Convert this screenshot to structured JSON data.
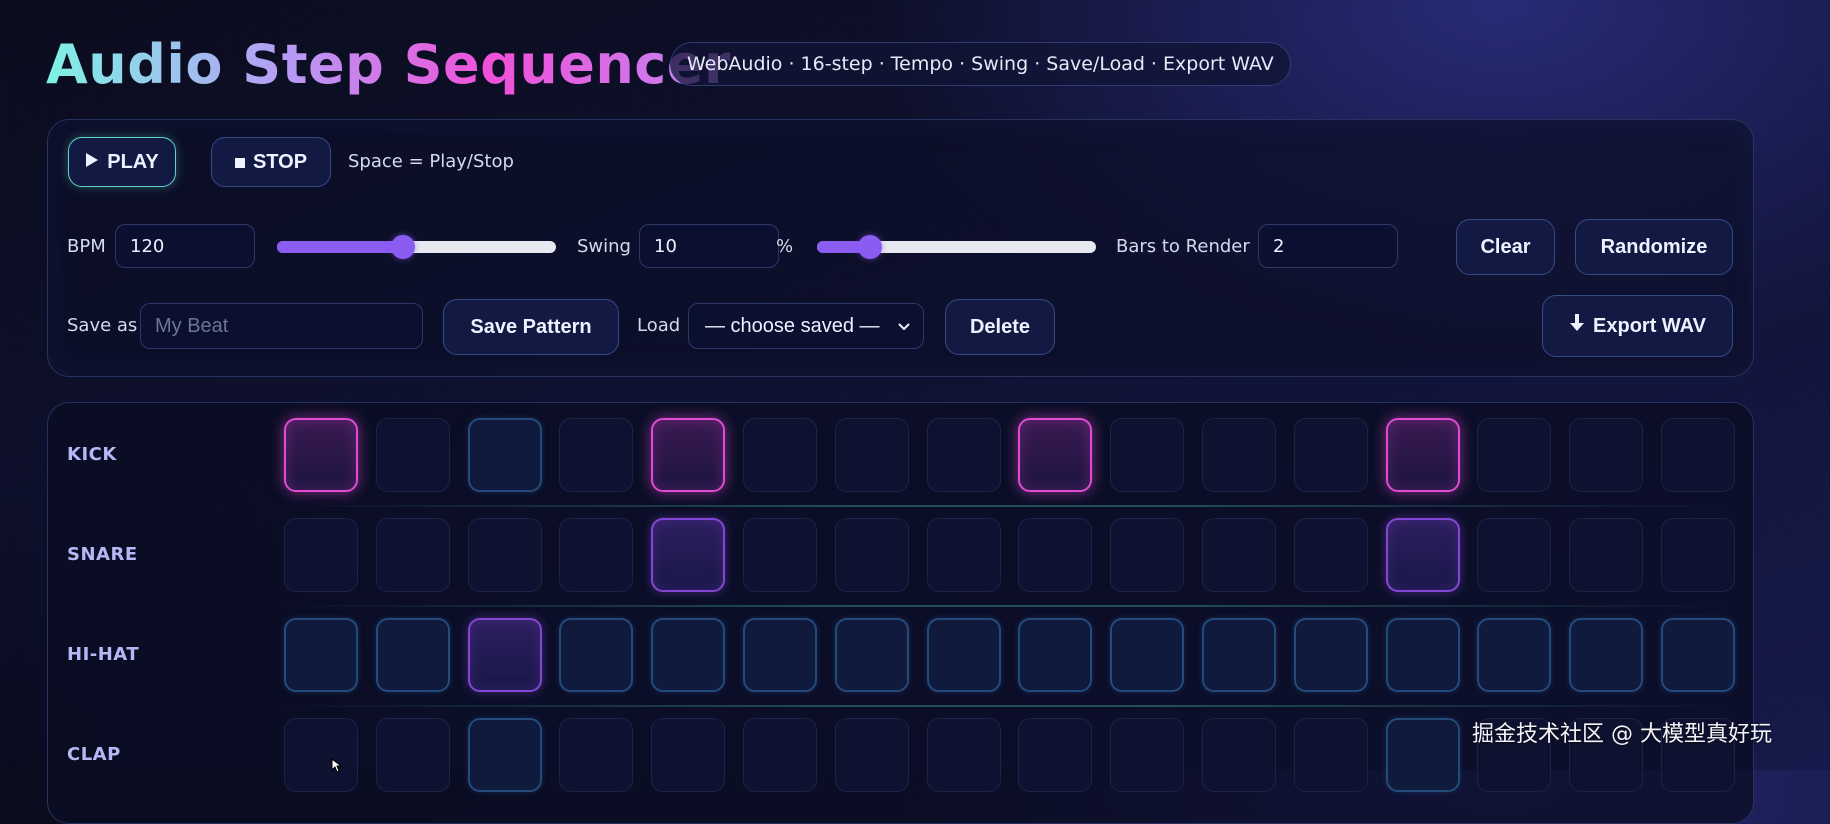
{
  "header": {
    "title": "Audio Step Sequencer",
    "subtitle": "WebAudio · 16-step · Tempo · Swing · Save/Load · Export WAV"
  },
  "transport": {
    "play_icon": "play-triangle-icon",
    "play_label": "PLAY",
    "stop_icon": "stop-square-icon",
    "stop_label": "STOP",
    "hint": "Space = Play/Stop"
  },
  "tempo": {
    "bpm_label": "BPM",
    "bpm_value": "120",
    "bpm_slider_fraction": 0.45,
    "swing_label": "Swing",
    "swing_value": "10",
    "swing_unit": "%",
    "swing_slider_fraction": 0.19,
    "bars_label": "Bars to Render",
    "bars_value": "2"
  },
  "actions": {
    "clear_label": "Clear",
    "randomize_label": "Randomize",
    "export_icon": "download-arrow-icon",
    "export_label": "Export WAV"
  },
  "storage": {
    "save_as_label": "Save as",
    "save_as_placeholder": "My Beat",
    "save_label": "Save Pattern",
    "load_label": "Load",
    "load_selected": "— choose saved —",
    "delete_label": "Delete"
  },
  "sequencer": {
    "steps": 16,
    "tracks": [
      {
        "name": "KICK",
        "steps": [
          "kick",
          "off",
          "beat",
          "off",
          "kick",
          "off",
          "off",
          "off",
          "kick",
          "off",
          "off",
          "off",
          "kick",
          "off",
          "off",
          "off"
        ]
      },
      {
        "name": "SNARE",
        "steps": [
          "off",
          "off",
          "off",
          "off",
          "violet",
          "off",
          "off",
          "off",
          "off",
          "off",
          "off",
          "off",
          "violet",
          "off",
          "off",
          "off"
        ]
      },
      {
        "name": "HI-HAT",
        "steps": [
          "beat",
          "beat",
          "violet",
          "beat",
          "beat",
          "beat",
          "beat",
          "beat",
          "beat",
          "beat",
          "beat",
          "beat",
          "beat",
          "beat",
          "beat",
          "beat"
        ]
      },
      {
        "name": "CLAP",
        "steps": [
          "off",
          "off",
          "beat",
          "off",
          "off",
          "off",
          "off",
          "off",
          "off",
          "off",
          "off",
          "off",
          "beat",
          "off",
          "off",
          "off"
        ]
      }
    ]
  },
  "colors": {
    "kick_active": "#e04bd0",
    "violet_active": "#8347d6",
    "beat_marker": "#234a7a",
    "slider_accent": "#8a5cf2",
    "play_border": "#5fd3c8"
  },
  "watermark": "掘金技术社区 @ 大模型真好玩"
}
